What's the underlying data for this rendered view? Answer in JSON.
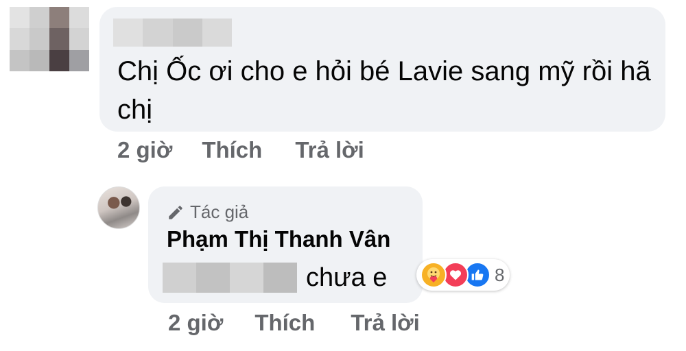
{
  "comment": {
    "text": "Chị Ốc ơi cho e hỏi bé Lavie sang mỹ rồi hã chị",
    "time": "2 giờ",
    "like_label": "Thích",
    "reply_label": "Trả lời"
  },
  "reply": {
    "author_badge": "Tác giả",
    "author_name": "Phạm Thị Thanh Vân",
    "text": "chưa e",
    "reaction_count": "8",
    "reactions": [
      "care-reaction-icon",
      "love-reaction-icon",
      "like-reaction-icon"
    ],
    "time": "2 giờ",
    "like_label": "Thích",
    "reply_label": "Trả lời"
  },
  "colors": {
    "bubble": "#f0f2f5",
    "meta_text": "#65676b",
    "like_blue": "#1877f2",
    "love_red": "#f33e58",
    "care_yellow": "#f7b125"
  }
}
